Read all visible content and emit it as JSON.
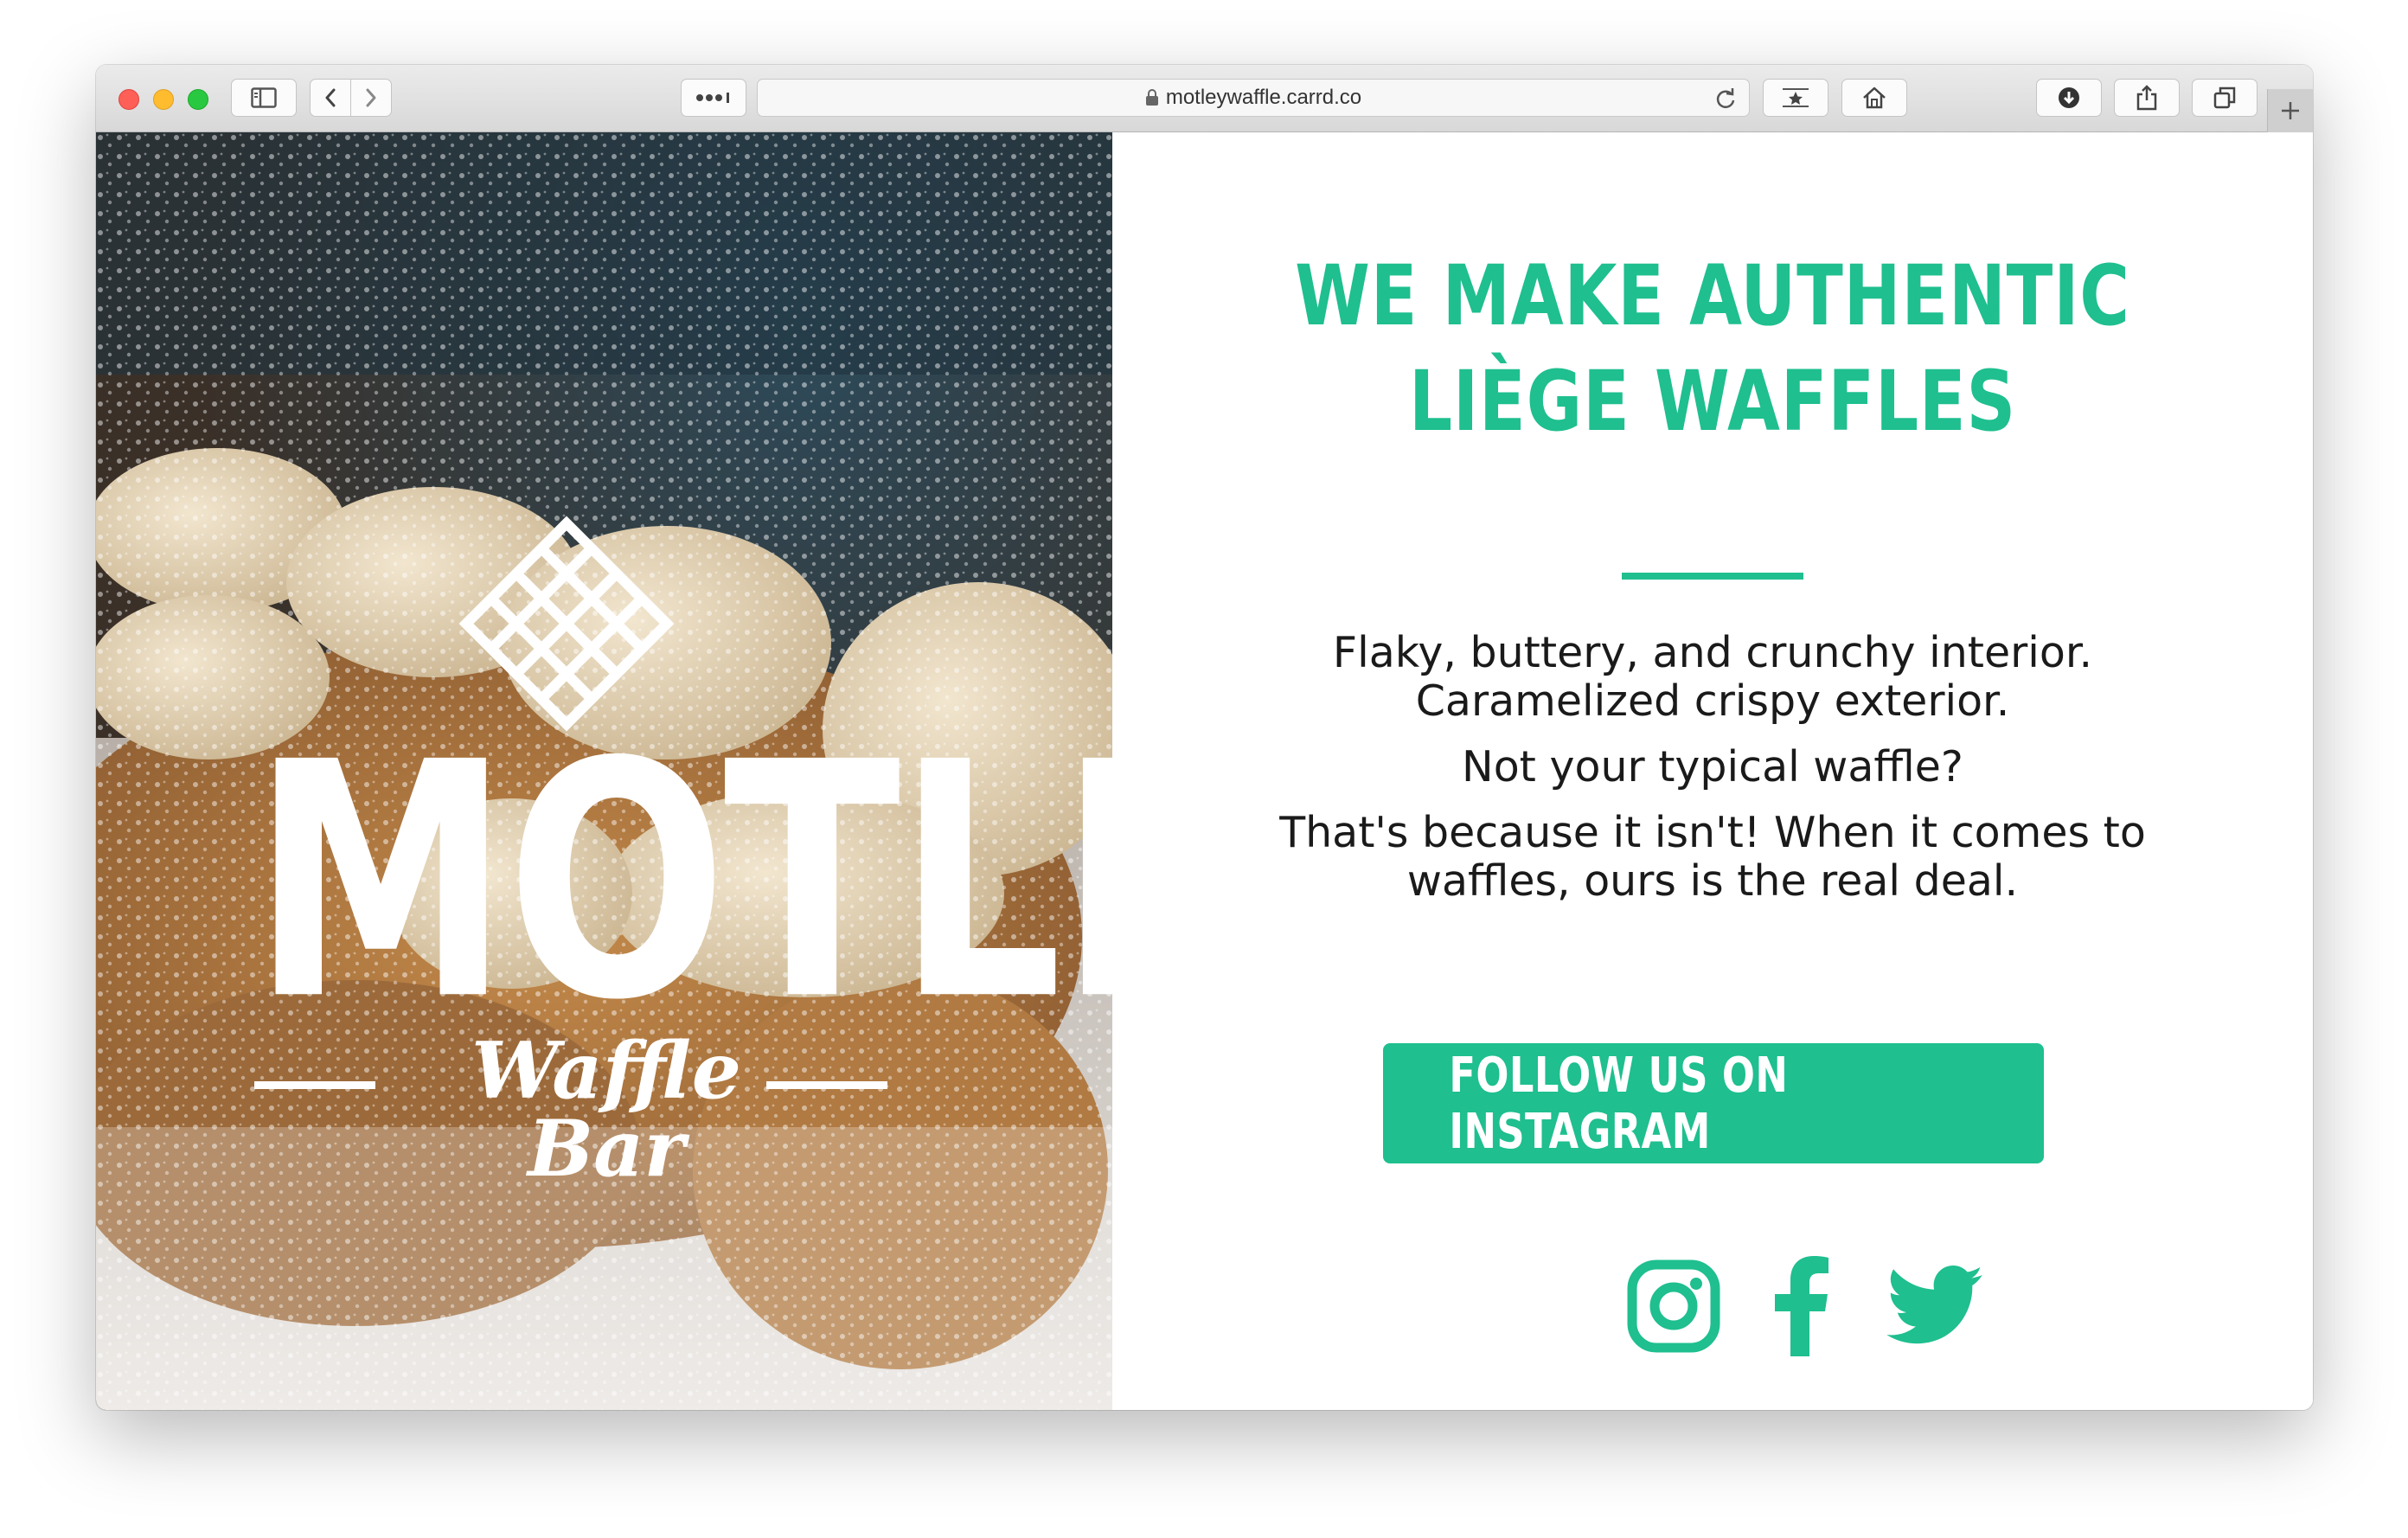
{
  "browser": {
    "url": "motleywaffle.carrd.co",
    "icons": [
      "sidebar-icon",
      "back-icon",
      "forward-icon",
      "more-icon",
      "lock-icon",
      "reload-icon",
      "bookmark-icon",
      "home-icon",
      "download-icon",
      "share-icon",
      "tabs-icon",
      "new-tab-icon"
    ]
  },
  "hero": {
    "brand_name": "MOTLEY",
    "brand_tagline": "Waffle Bar",
    "logo_icon": "waffle-grid-icon"
  },
  "main": {
    "headline_line1": "WE MAKE AUTHENTIC",
    "headline_line2": "LIÈGE WAFFLES",
    "para1_line1": "Flaky, buttery, and crunchy interior.",
    "para1_line2": "Caramelized crispy exterior.",
    "para2": "Not your typical waffle?",
    "para3_line1": "That's because it isn't! When it comes to",
    "para3_line2": "waffles, ours is the real deal.",
    "cta_label": "FOLLOW US ON INSTAGRAM",
    "social": [
      "instagram-icon",
      "facebook-icon",
      "twitter-icon"
    ]
  },
  "colors": {
    "accent": "#1fbf8f",
    "text": "#1a1a1a",
    "background": "#ffffff"
  }
}
